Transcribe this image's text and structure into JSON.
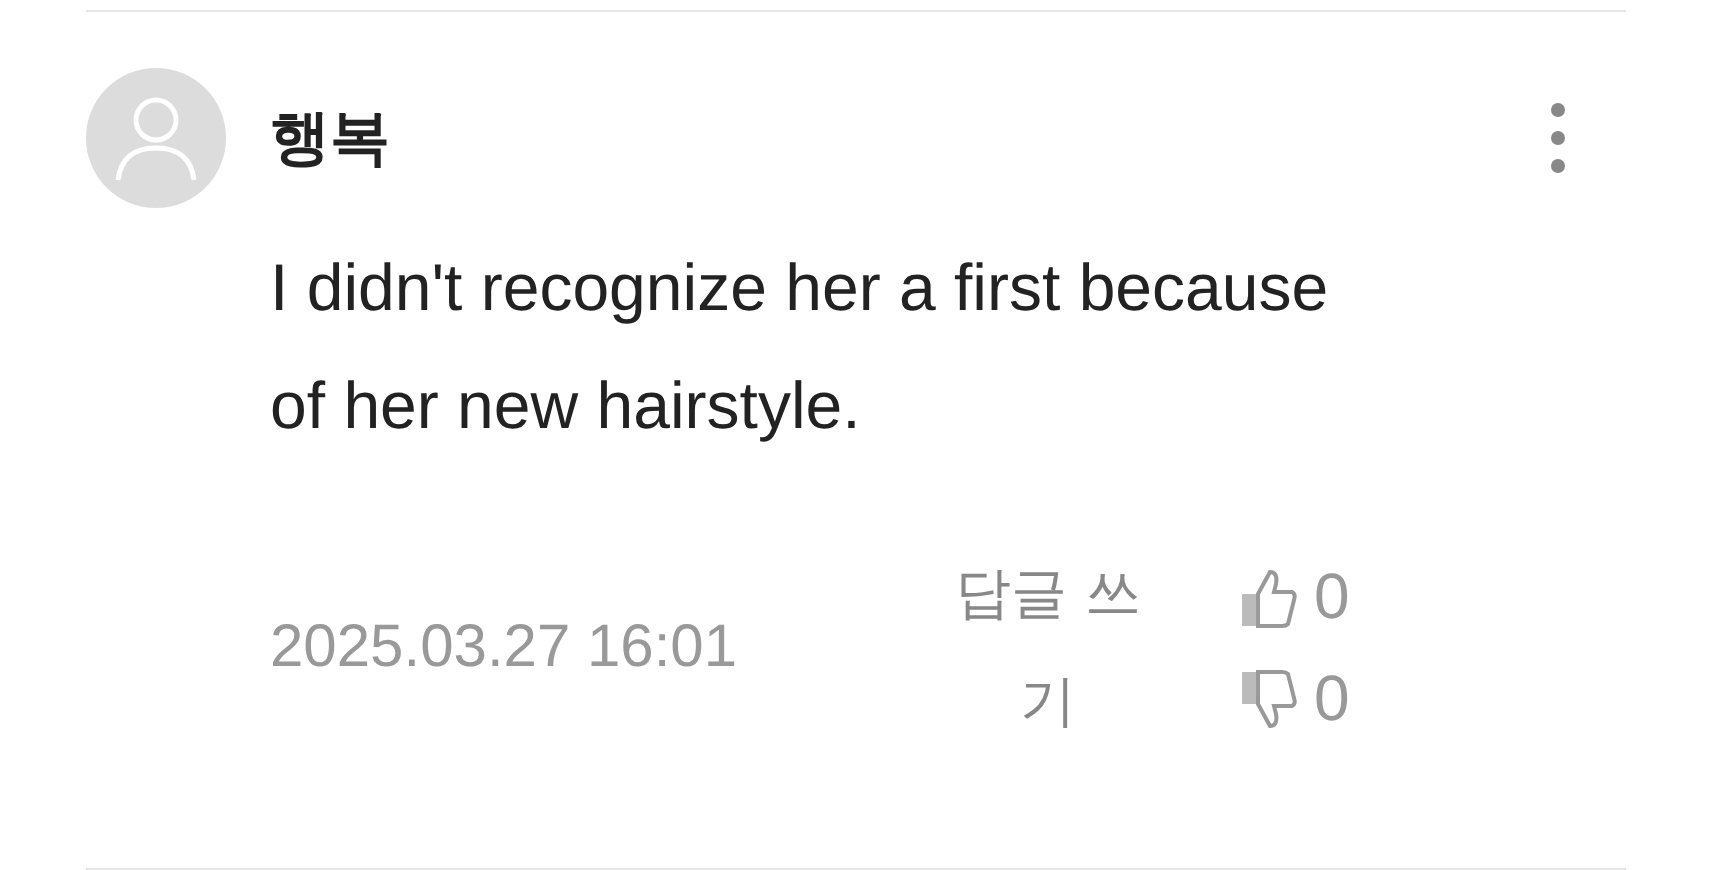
{
  "comment": {
    "author": "행복",
    "text": "I didn't recognize her a first because of her new hairstyle.",
    "date": "2025.03.27 16:01",
    "reply_label": "답글 쓰기",
    "likes": "0",
    "dislikes": "0"
  }
}
